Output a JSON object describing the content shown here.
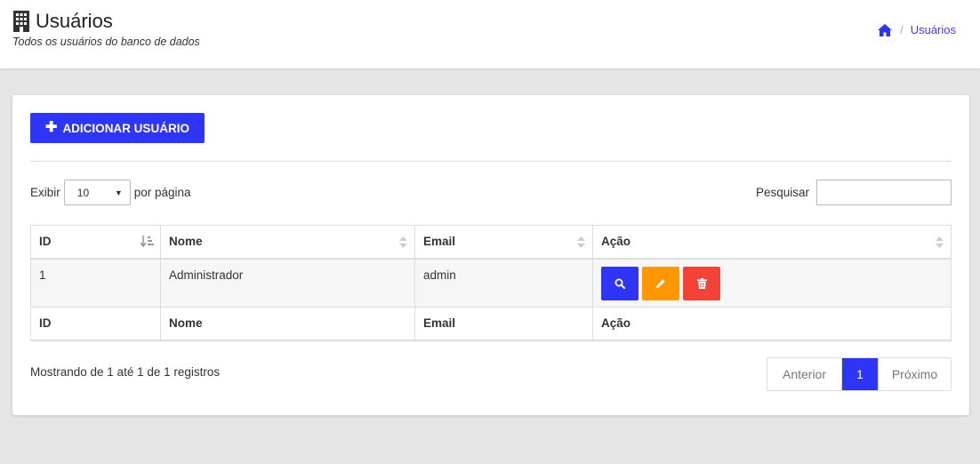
{
  "header": {
    "title": "Usuários",
    "subtitle": "Todos os usuários do banco de dados",
    "breadcrumb": {
      "separator": "/",
      "current": "Usuários"
    }
  },
  "toolbar": {
    "add_label": "ADICIONAR USUÁRIO"
  },
  "length_menu": {
    "prefix": "Exibir",
    "value": "10",
    "suffix": "por página"
  },
  "search": {
    "label": "Pesquisar",
    "value": ""
  },
  "table": {
    "columns": [
      "ID",
      "Nome",
      "Email",
      "Ação"
    ],
    "rows": [
      {
        "id": "1",
        "nome": "Administrador",
        "email": "admin"
      }
    ]
  },
  "info": "Mostrando de 1 até 1 de 1 registros",
  "pagination": {
    "prev": "Anterior",
    "current": "1",
    "next": "Próximo"
  },
  "colors": {
    "primary": "#2e35f5",
    "warning": "#ff9800",
    "danger": "#f44336"
  },
  "icons": {
    "title": "building-icon",
    "breadcrumb_home": "home-icon",
    "view": "search-icon",
    "edit": "pencil-icon",
    "delete": "trash-icon"
  }
}
